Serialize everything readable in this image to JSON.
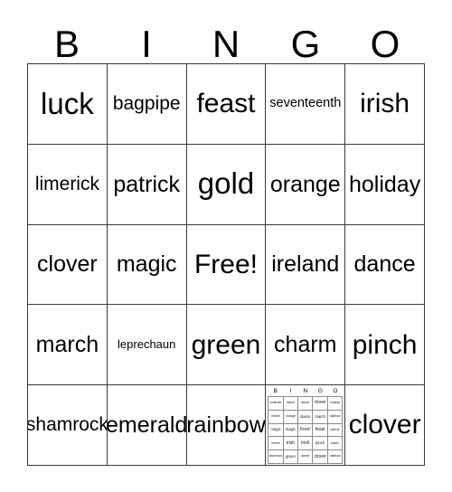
{
  "header": {
    "letters": [
      "B",
      "I",
      "N",
      "G",
      "O"
    ]
  },
  "card": {
    "free_space_label": "Free!",
    "rows": [
      [
        {
          "text": "luck",
          "size": "fs-xl"
        },
        {
          "text": "bagpipe",
          "size": "fs-sm"
        },
        {
          "text": "feast",
          "size": "fs-lg"
        },
        {
          "text": "seventeenth",
          "size": "fs-xxs"
        },
        {
          "text": "irish",
          "size": "fs-lg"
        }
      ],
      [
        {
          "text": "limerick",
          "size": "fs-sm"
        },
        {
          "text": "patrick",
          "size": "fs-md"
        },
        {
          "text": "gold",
          "size": "fs-xl"
        },
        {
          "text": "orange",
          "size": "fs-md"
        },
        {
          "text": "holiday",
          "size": "fs-md"
        }
      ],
      [
        {
          "text": "clover",
          "size": "fs-md"
        },
        {
          "text": "magic",
          "size": "fs-md"
        },
        {
          "text": "Free!",
          "size": "fs-lg"
        },
        {
          "text": "ireland",
          "size": "fs-md"
        },
        {
          "text": "dance",
          "size": "fs-md"
        }
      ],
      [
        {
          "text": "march",
          "size": "fs-md"
        },
        {
          "text": "leprechaun",
          "size": "fs-tiny"
        },
        {
          "text": "green",
          "size": "fs-lg"
        },
        {
          "text": "charm",
          "size": "fs-md"
        },
        {
          "text": "pinch",
          "size": "fs-lg"
        }
      ],
      [
        {
          "text": "shamrock",
          "size": "fs-sm"
        },
        {
          "text": "emerald",
          "size": "fs-md"
        },
        {
          "text": "rainbow",
          "size": "fs-md"
        },
        {
          "text": "",
          "size": "fs-sm",
          "type": "mini-card"
        },
        {
          "text": "clover",
          "size": "fs-lg"
        }
      ]
    ]
  },
  "mini_card": {
    "letters": [
      "B",
      "I",
      "N",
      "G",
      "O"
    ],
    "rows": [
      [
        {
          "text": "emerald",
          "emphasis": "small"
        },
        {
          "text": "march",
          "emphasis": "small"
        },
        {
          "text": "dance",
          "emphasis": "small"
        },
        {
          "text": "clover",
          "emphasis": "big"
        },
        {
          "text": "holiday",
          "emphasis": "small"
        }
      ],
      [
        {
          "text": "march",
          "emphasis": "small"
        },
        {
          "text": "orange",
          "emphasis": "small"
        },
        {
          "text": "dance",
          "emphasis": "mid"
        },
        {
          "text": "march",
          "emphasis": "mid"
        },
        {
          "text": "rainbow",
          "emphasis": "small"
        }
      ],
      [
        {
          "text": "magic",
          "emphasis": "mid"
        },
        {
          "text": "magic",
          "emphasis": "mid"
        },
        {
          "text": "Free!",
          "emphasis": "big"
        },
        {
          "text": "feast",
          "emphasis": "big"
        },
        {
          "text": "patrick",
          "emphasis": "small"
        }
      ],
      [
        {
          "text": "march",
          "emphasis": "small"
        },
        {
          "text": "irish",
          "emphasis": "big"
        },
        {
          "text": "irish",
          "emphasis": "big"
        },
        {
          "text": "pinch",
          "emphasis": "mid"
        },
        {
          "text": "charm",
          "emphasis": "small"
        }
      ],
      [
        {
          "text": "shamrock",
          "emphasis": "small"
        },
        {
          "text": "green",
          "emphasis": "mid"
        },
        {
          "text": "dance",
          "emphasis": "small"
        },
        {
          "text": "clover",
          "emphasis": "big"
        },
        {
          "text": "rainbow",
          "emphasis": "small"
        }
      ]
    ]
  },
  "colors": {
    "background": "#ffffff",
    "text": "#000000",
    "grid_line": "#3a3a3a",
    "mini_grid_line": "#8a8a8a"
  }
}
